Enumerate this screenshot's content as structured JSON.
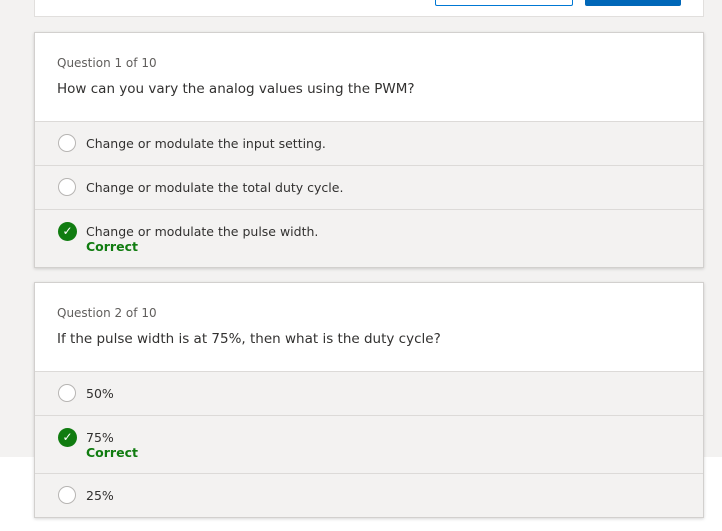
{
  "quiz": {
    "questions": [
      {
        "number": "Question 1 of 10",
        "text": "How can you vary the analog values using the PWM?",
        "options": [
          {
            "label": "Change or modulate the input setting.",
            "state": "unselected"
          },
          {
            "label": "Change or modulate the total duty cycle.",
            "state": "unselected"
          },
          {
            "label": "Change or modulate the pulse width.",
            "state": "correct",
            "status": "Correct"
          }
        ]
      },
      {
        "number": "Question 2 of 10",
        "text": "If the pulse width is at 75%, then what is the duty cycle?",
        "options": [
          {
            "label": "50%",
            "state": "unselected"
          },
          {
            "label": "75%",
            "state": "correct",
            "status": "Correct"
          },
          {
            "label": "25%",
            "state": "unselected"
          }
        ]
      }
    ],
    "icons": {
      "selected": "checkmark-circle-icon",
      "unselected": "radio-empty-icon"
    },
    "colors": {
      "correct": "#107c10",
      "accent": "#0067b8",
      "page_bg": "#f3f2f1"
    }
  }
}
